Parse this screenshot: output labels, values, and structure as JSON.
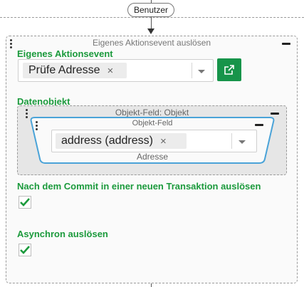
{
  "lane": {
    "label": "Benutzer"
  },
  "block": {
    "title": "Eigenes Aktionsevent auslösen",
    "event_label": "Eigenes Aktionsevent",
    "event_select": {
      "value": "Prüfe Adresse",
      "remove": "×"
    },
    "data_object_label": "Datenobjekt",
    "object_field_block": {
      "title": "Objekt-Feld: Objekt",
      "field": {
        "title": "Objekt-Feld",
        "value": "address (address)",
        "remove": "×",
        "caption": "Adresse"
      }
    },
    "commit_label": "Nach dem Commit in einer neuen Transaktion auslösen",
    "commit_checked": true,
    "async_label": "Asynchron auslösen",
    "async_checked": true
  },
  "colors": {
    "accent": "#1b9a3c",
    "button": "#17944a",
    "field_border": "#4aa3d8"
  },
  "icons": [
    "drag-handle-icon",
    "collapse-icon",
    "remove-icon",
    "chevron-down-icon",
    "external-link-icon",
    "checkmark-icon"
  ]
}
